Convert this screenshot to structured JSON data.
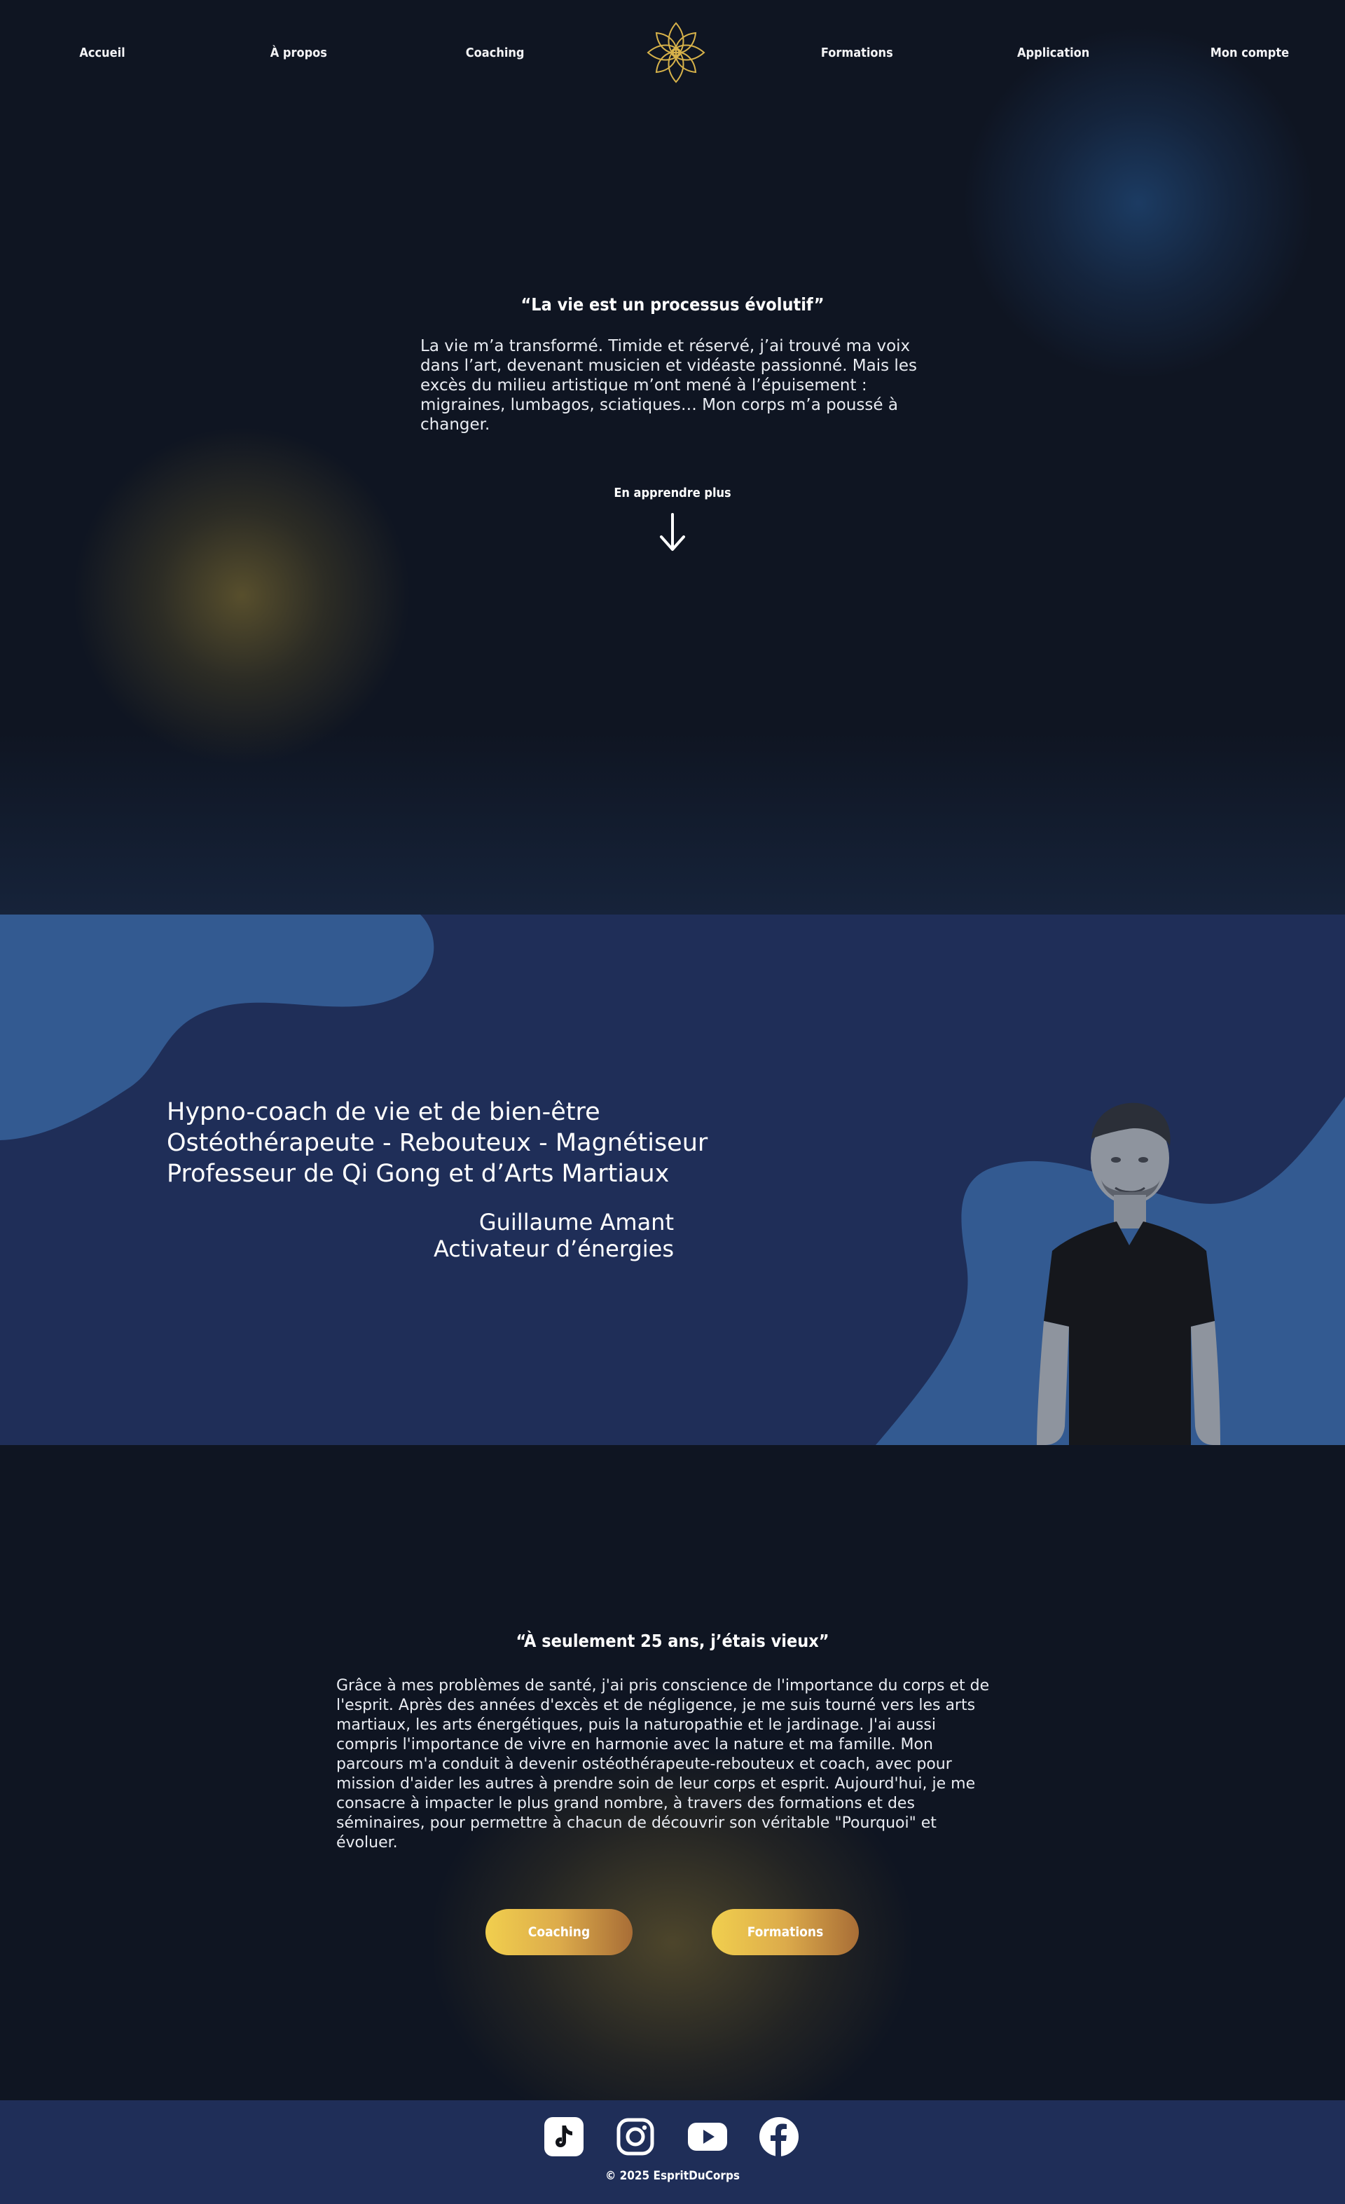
{
  "nav": {
    "items": [
      {
        "label": "Accueil"
      },
      {
        "label": "À propos"
      },
      {
        "label": "Coaching"
      },
      {
        "label": "Formations"
      },
      {
        "label": "Application"
      },
      {
        "label": "Mon compte"
      }
    ],
    "logo_icon": "lotus-logo-icon"
  },
  "hero": {
    "quote": "“La vie est un processus évolutif”",
    "lines": [
      "La vie m’a transformé. Timide et réservé, j’ai trouvé ma voix",
      "dans l’art, devenant musicien et vidéaste passionné. Mais les",
      "excès du milieu artistique m’ont mené à l’épuisement :",
      "migraines, lumbagos, sciatiques… Mon corps m’a poussé à",
      "changer."
    ],
    "learn_more": "En apprendre plus"
  },
  "band": {
    "titles": [
      "Hypno-coach de vie et de bien-être",
      "Ostéothérapeute - Rebouteux - Magnétiseur",
      "Professeur de Qi Gong et d’Arts Martiaux"
    ],
    "name": "Guillaume Amant",
    "role": "Activateur d’énergies"
  },
  "about": {
    "quote": "“À seulement 25 ans, j’étais vieux”",
    "lines": [
      "Grâce à mes problèmes de santé, j'ai pris conscience de l'importance du corps et de",
      "l'esprit. Après des années d'excès et de négligence, je me suis tourné vers les arts",
      "martiaux, les arts énergétiques, puis la naturopathie et le jardinage. J'ai aussi",
      "compris l'importance de vivre en harmonie avec la nature et ma famille. Mon",
      "parcours m'a conduit à devenir ostéothérapeute-rebouteux et coach, avec pour",
      "mission d'aider les autres à prendre soin de leur corps et esprit. Aujourd'hui, je me",
      "consacre à impacter le plus grand nombre, à travers des formations et des",
      "séminaires, pour permettre à chacun de découvrir son véritable \"Pourquoi\" et",
      "évoluer."
    ],
    "buttons": [
      {
        "label": "Coaching"
      },
      {
        "label": "Formations"
      }
    ]
  },
  "footer": {
    "social": [
      "tiktok-icon",
      "instagram-icon",
      "youtube-icon",
      "facebook-icon"
    ],
    "copyright": "© 2025 EspritDuCorps"
  },
  "colors": {
    "background": "#0f1522",
    "band": "#1f2e58",
    "band_shape": "#335a91",
    "gold": "#d7b24a"
  }
}
